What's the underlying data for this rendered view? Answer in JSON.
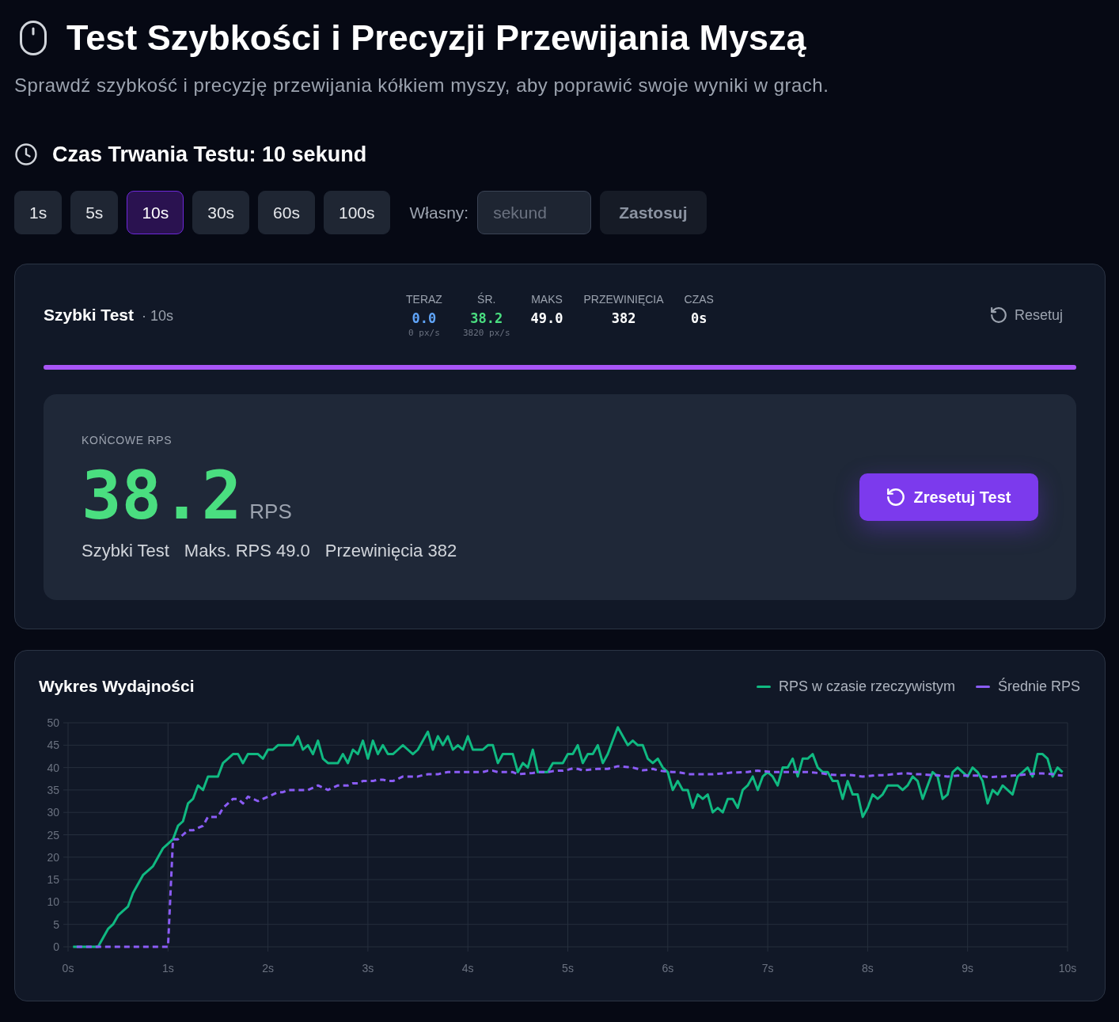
{
  "header": {
    "title": "Test Szybkości i Precyzji Przewijania Myszą",
    "subtitle": "Sprawdź szybkość i precyzję przewijania kółkiem myszy, aby poprawić swoje wyniki w grach."
  },
  "duration": {
    "heading": "Czas Trwania Testu: 10 sekund",
    "options": [
      {
        "label": "1s",
        "selected": false
      },
      {
        "label": "5s",
        "selected": false
      },
      {
        "label": "10s",
        "selected": true
      },
      {
        "label": "30s",
        "selected": false
      },
      {
        "label": "60s",
        "selected": false
      },
      {
        "label": "100s",
        "selected": false
      }
    ],
    "custom_label": "Własny:",
    "custom_input": {
      "placeholder": "sekund"
    },
    "apply_button": {
      "label": "Zastosuj",
      "disabled": true
    }
  },
  "test_panel": {
    "title": "Szybki Test",
    "duration": "· 10s",
    "stats": [
      {
        "label": "TERAZ",
        "value": "0.0",
        "sub": "0 px/s",
        "color": "#60a5fa"
      },
      {
        "label": "ŚR.",
        "value": "38.2",
        "sub": "3820 px/s",
        "color": "#4ade80"
      },
      {
        "label": "MAKS",
        "value": "49.0",
        "color": "#ffffff"
      },
      {
        "label": "PRZEWINIĘCIA",
        "value": "382",
        "color": "#ffffff"
      },
      {
        "label": "CZAS",
        "value": "0s",
        "color": "#ffffff"
      }
    ],
    "reset_link": "Resetuj",
    "progress": {
      "level": 1
    },
    "result": {
      "label": "KOŃCOWE RPS",
      "value": "38.2",
      "unit": "RPS",
      "details": [
        "Szybki Test",
        "Maks. RPS 49.0",
        "Przewinięcia 382"
      ],
      "button": "Zresetuj Test"
    }
  },
  "chart_panel": {
    "title": "Wykres Wydajności",
    "chart_data": {
      "type": "line",
      "grid": true,
      "x": [
        0.05,
        0.1,
        0.15,
        0.2,
        0.25,
        0.3,
        0.35,
        0.4,
        0.45,
        0.5,
        0.55,
        0.6,
        0.65,
        0.7,
        0.75,
        0.8,
        0.85,
        0.9,
        0.95,
        1,
        1.05,
        1.1,
        1.15,
        1.2,
        1.25,
        1.3,
        1.35,
        1.4,
        1.45,
        1.5,
        1.55,
        1.6,
        1.65,
        1.7,
        1.75,
        1.8,
        1.85,
        1.9,
        1.95,
        2,
        2.05,
        2.1,
        2.15,
        2.2,
        2.25,
        2.3,
        2.35,
        2.4,
        2.45,
        2.5,
        2.55,
        2.6,
        2.65,
        2.7,
        2.75,
        2.8,
        2.85,
        2.9,
        2.95,
        3,
        3.05,
        3.1,
        3.15,
        3.2,
        3.25,
        3.3,
        3.35,
        3.4,
        3.45,
        3.5,
        3.55,
        3.6,
        3.65,
        3.7,
        3.75,
        3.8,
        3.85,
        3.9,
        3.95,
        4,
        4.05,
        4.1,
        4.15,
        4.2,
        4.25,
        4.3,
        4.35,
        4.4,
        4.45,
        4.5,
        4.55,
        4.6,
        4.65,
        4.7,
        4.75,
        4.8,
        4.85,
        4.9,
        4.95,
        5,
        5.05,
        5.1,
        5.15,
        5.2,
        5.25,
        5.3,
        5.35,
        5.4,
        5.45,
        5.5,
        5.55,
        5.6,
        5.65,
        5.7,
        5.75,
        5.8,
        5.85,
        5.9,
        5.95,
        6,
        6.05,
        6.1,
        6.15,
        6.2,
        6.25,
        6.3,
        6.35,
        6.4,
        6.45,
        6.5,
        6.55,
        6.6,
        6.65,
        6.7,
        6.75,
        6.8,
        6.85,
        6.9,
        6.95,
        7,
        7.05,
        7.1,
        7.15,
        7.2,
        7.25,
        7.3,
        7.35,
        7.4,
        7.45,
        7.5,
        7.55,
        7.6,
        7.65,
        7.7,
        7.75,
        7.8,
        7.85,
        7.9,
        7.95,
        8,
        8.05,
        8.1,
        8.15,
        8.2,
        8.25,
        8.3,
        8.35,
        8.4,
        8.45,
        8.5,
        8.55,
        8.6,
        8.65,
        8.7,
        8.75,
        8.8,
        8.85,
        8.9,
        8.95,
        9,
        9.05,
        9.1,
        9.15,
        9.2,
        9.25,
        9.3,
        9.35,
        9.4,
        9.45,
        9.5,
        9.55,
        9.6,
        9.65,
        9.7,
        9.75,
        9.8,
        9.85,
        9.9,
        9.95
      ],
      "series": [
        {
          "name": "RPS w czasie rzeczywistym",
          "color": "#10b981",
          "line_style": "solid",
          "values": [
            0,
            0,
            0,
            0,
            0,
            0,
            2,
            4,
            5,
            7,
            8,
            9,
            12,
            14,
            16,
            17,
            18,
            20,
            22,
            23,
            24,
            27,
            28,
            32,
            33,
            36,
            35,
            38,
            38,
            38,
            41,
            42,
            43,
            43,
            41,
            43,
            43,
            43,
            42,
            44,
            44,
            45,
            45,
            45,
            45,
            47,
            44,
            45,
            43,
            46,
            42,
            41,
            41,
            41,
            43,
            41,
            44,
            43,
            46,
            42,
            46,
            43,
            45,
            43,
            43,
            44,
            45,
            44,
            43,
            44,
            46,
            48,
            44,
            47,
            45,
            47,
            44,
            45,
            44,
            47,
            44,
            44,
            44,
            45,
            45,
            41,
            43,
            43,
            43,
            39,
            41,
            40,
            44,
            39,
            39,
            39,
            41,
            41,
            41,
            43,
            43,
            45,
            41,
            43,
            43,
            45,
            41,
            43,
            46,
            49,
            47,
            45,
            46,
            45,
            45,
            42,
            41,
            42,
            40,
            39,
            35,
            37,
            35,
            35,
            31,
            34,
            33,
            34,
            30,
            31,
            30,
            33,
            33,
            31,
            35,
            36,
            38,
            35,
            38,
            39,
            38,
            36,
            40,
            40,
            42,
            38,
            42,
            42,
            43,
            40,
            39,
            39,
            37,
            37,
            33,
            37,
            34,
            34,
            29,
            31,
            34,
            33,
            34,
            36,
            36,
            36,
            35,
            36,
            38,
            37,
            33,
            36,
            39,
            38,
            33,
            34,
            39,
            40,
            39,
            38,
            40,
            39,
            37,
            32,
            35,
            34,
            36,
            35,
            34,
            38,
            39,
            40,
            38,
            43,
            43,
            42,
            38,
            40,
            39
          ]
        },
        {
          "name": "Średnie RPS",
          "color": "#8b5cf6",
          "line_style": "dashed",
          "values": [
            0,
            0,
            0,
            0,
            0,
            0,
            0,
            0,
            0,
            0,
            0,
            0,
            0,
            0,
            0,
            0,
            0,
            0,
            0,
            0,
            24,
            24,
            25,
            26,
            26,
            26.5,
            27,
            29,
            29,
            29,
            31,
            32,
            33,
            33,
            32,
            33.5,
            33,
            32.5,
            33,
            33.5,
            34,
            34.5,
            34.5,
            35,
            35,
            35,
            35,
            35,
            35.5,
            36,
            35.5,
            35,
            35.5,
            36,
            36,
            36,
            36.5,
            36.5,
            37,
            37,
            37,
            37.3,
            37.3,
            37,
            37,
            37.5,
            38,
            38,
            38,
            38,
            38.3,
            38.5,
            38.5,
            38.5,
            38.8,
            39,
            39,
            39,
            39,
            39,
            39,
            39,
            39,
            39.3,
            39.3,
            39,
            39,
            39,
            39,
            38.5,
            38.6,
            38.7,
            38.8,
            39,
            39,
            39,
            39.2,
            39.3,
            39.3,
            39.5,
            39.8,
            39.7,
            39.4,
            39.5,
            39.6,
            39.7,
            39.7,
            39.7,
            40,
            40.3,
            40.2,
            40.1,
            40,
            39.7,
            39.4,
            39.5,
            39.7,
            39.4,
            39.2,
            39.1,
            39,
            39,
            38.8,
            38.5,
            38.5,
            38.5,
            38.5,
            38.5,
            38.5,
            38.6,
            38.7,
            38.8,
            38.9,
            38.9,
            39,
            39,
            39.2,
            39.3,
            39.2,
            39.1,
            39,
            39,
            39,
            39,
            39,
            39,
            39,
            39,
            38.9,
            38.8,
            38.7,
            38.5,
            38.4,
            38.3,
            38.3,
            38.4,
            38.3,
            38.1,
            38,
            38.1,
            38.2,
            38.3,
            38.3,
            38.4,
            38.5,
            38.6,
            38.7,
            38.7,
            38.6,
            38.5,
            38.5,
            38.4,
            38.3,
            38.3,
            38.1,
            38,
            38.1,
            38.2,
            38.2,
            38.2,
            38.2,
            38.2,
            38.1,
            37.9,
            37.9,
            38,
            38,
            38.1,
            38.2,
            38.3,
            38.4,
            38.5,
            38.6,
            38.7,
            38.7,
            38.6,
            38.5,
            38.3,
            38.2
          ]
        }
      ],
      "xlim": [
        0,
        10
      ],
      "ylim": [
        0,
        50
      ],
      "xticks": [
        {
          "value": 0,
          "label": "0s"
        },
        {
          "value": 1,
          "label": "1s"
        },
        {
          "value": 2,
          "label": "2s"
        },
        {
          "value": 3,
          "label": "3s"
        },
        {
          "value": 4,
          "label": "4s"
        },
        {
          "value": 5,
          "label": "5s"
        },
        {
          "value": 6,
          "label": "6s"
        },
        {
          "value": 7,
          "label": "7s"
        },
        {
          "value": 8,
          "label": "8s"
        },
        {
          "value": 9,
          "label": "9s"
        },
        {
          "value": 10,
          "label": "10s"
        }
      ],
      "yticks": [
        0,
        5,
        10,
        15,
        20,
        25,
        30,
        35,
        40,
        45,
        50
      ]
    }
  }
}
